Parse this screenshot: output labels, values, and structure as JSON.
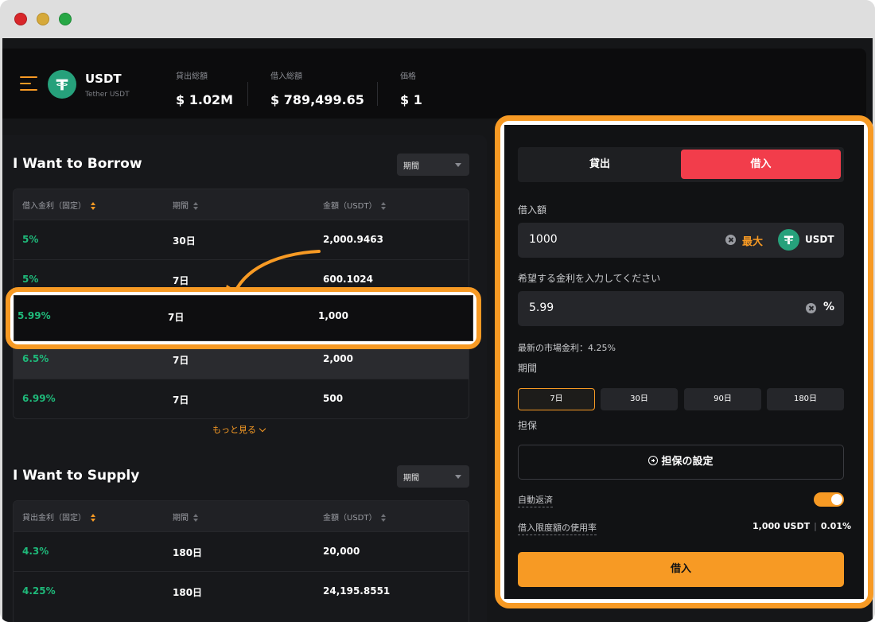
{
  "header": {
    "coin_symbol": "USDT",
    "coin_subtitle": "Tether USDT",
    "stats": [
      {
        "label": "貸出総額",
        "value": "$ 1.02M"
      },
      {
        "label": "借入総額",
        "value": "$ 789,499.65"
      },
      {
        "label": "価格",
        "value": "$ 1"
      }
    ]
  },
  "borrow_section": {
    "title": "I Want to Borrow",
    "period_select": "期間",
    "columns": [
      "借入金利（固定）",
      "期間",
      "金額（USDT）"
    ],
    "rows": [
      {
        "rate": "5%",
        "period": "30日",
        "amount": "2,000.9463"
      },
      {
        "rate": "5%",
        "period": "7日",
        "amount": "600.1024"
      },
      {
        "rate": "5.99%",
        "period": "7日",
        "amount": "1,000"
      },
      {
        "rate": "6.5%",
        "period": "7日",
        "amount": "2,000"
      },
      {
        "rate": "6.99%",
        "period": "7日",
        "amount": "500"
      }
    ],
    "more_label": "もっと見る"
  },
  "supply_section": {
    "title": "I Want to Supply",
    "period_select": "期間",
    "columns": [
      "貸出金利（固定）",
      "期間",
      "金額（USDT）"
    ],
    "rows": [
      {
        "rate": "4.3%",
        "period": "180日",
        "amount": "20,000"
      },
      {
        "rate": "4.25%",
        "period": "180日",
        "amount": "24,195.8551"
      }
    ]
  },
  "order_form": {
    "tabs": {
      "lend": "貸出",
      "borrow": "借入"
    },
    "active_tab": "borrow",
    "amount_label": "借入額",
    "amount_value": "1000",
    "max_label": "最大",
    "token_label": "USDT",
    "rate_label": "希望する金利を入力してください",
    "rate_value": "5.99",
    "rate_unit": "%",
    "market_rate": "最新の市場金利：4.25%",
    "period_label": "期間",
    "periods": [
      "7日",
      "30日",
      "90日",
      "180日"
    ],
    "selected_period": "7日",
    "collateral_label": "担保",
    "collateral_button": "担保の設定",
    "auto_repay_label": "自動返済",
    "auto_repay_on": true,
    "usage_label": "借入限度額の使用率",
    "usage_amount": "1,000 USDT",
    "usage_percent": "0.01%",
    "submit_label": "借入"
  },
  "colors": {
    "accent": "#f79a24",
    "borrow_tab": "#f23d4b",
    "rate_green": "#1fb97a",
    "tether": "#26a17b"
  }
}
